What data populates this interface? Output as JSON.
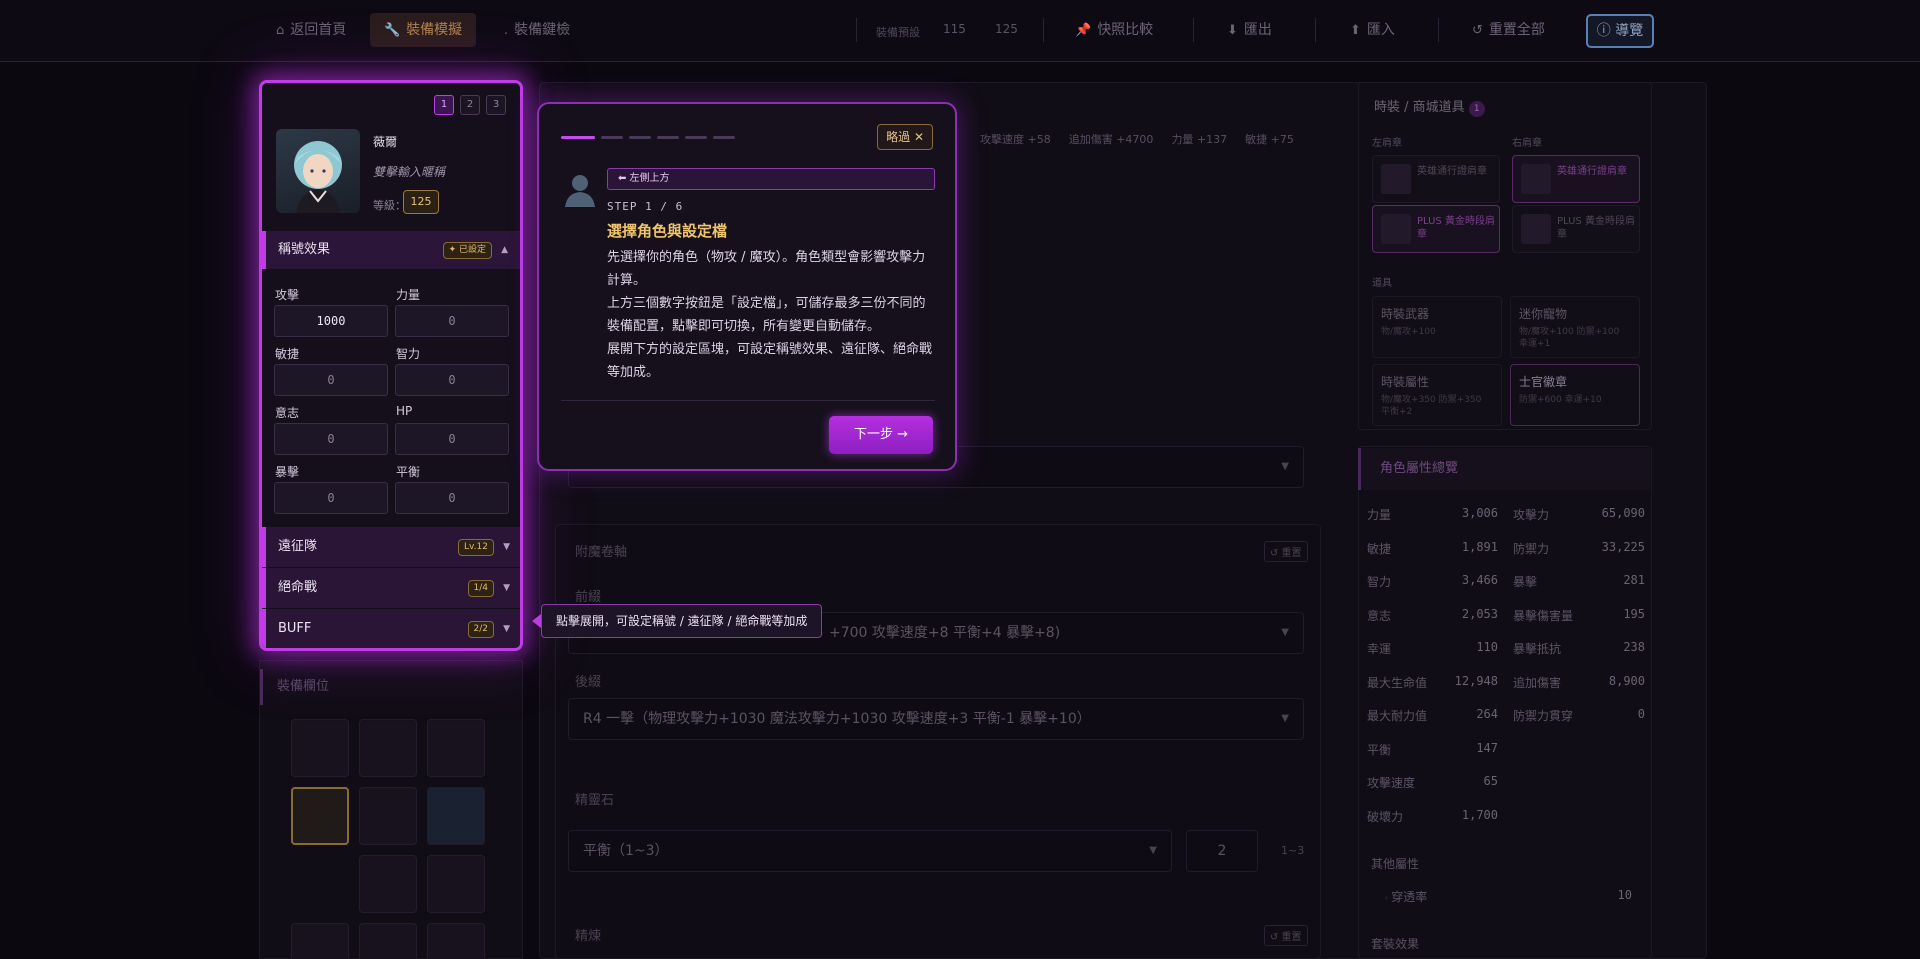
{
  "topbar": {
    "home": "返回首頁",
    "equip_sim": "裝備模擬",
    "shortcuts": "裝備鍵檢",
    "preset_label": "裝備預設",
    "preset_a": "115",
    "preset_b": "125",
    "quick_compare": "快照比較",
    "export": "匯出",
    "import": "匯入",
    "reset_all": "重置全部",
    "guide": "導覽"
  },
  "sidebar": {
    "slots": [
      "1",
      "2",
      "3"
    ],
    "character": {
      "name": "薇爾",
      "desc": "雙擊輸入暱稱",
      "level_label": "等級：",
      "level": "125"
    },
    "title_effect": {
      "label": "稱號效果",
      "badge": "✦ 已設定",
      "arrow": "▲",
      "stats": [
        {
          "label": "攻擊",
          "value": "1000"
        },
        {
          "label": "力量",
          "value": "0"
        },
        {
          "label": "敏捷",
          "value": "0"
        },
        {
          "label": "智力",
          "value": "0"
        },
        {
          "label": "意志",
          "value": "0"
        },
        {
          "label": "HP",
          "value": "0"
        },
        {
          "label": "暴擊",
          "value": "0"
        },
        {
          "label": "平衡",
          "value": "0"
        }
      ]
    },
    "accordions": [
      {
        "label": "遠征隊",
        "badge": "Lv.12",
        "arrow": "▼"
      },
      {
        "label": "絕命戰",
        "badge": "1/4",
        "arrow": "▼"
      },
      {
        "label": "BUFF",
        "badge": "2/2",
        "arrow": "▼"
      }
    ],
    "equipment_header": "裝備欄位"
  },
  "hint": {
    "text": "點擊展開，可設定稱號 / 遠征隊 / 絕命戰等加成"
  },
  "tour": {
    "position": "⬅ 左側上方",
    "step": "STEP 1 / 6",
    "title": "選擇角色與設定檔",
    "p1": "先選擇你的角色（物攻 / 魔攻）。角色類型會影響攻擊力計算。",
    "p2": "上方三個數字按鈕是「設定檔」，可儲存最多三份不同的裝備配置，點擊即可切換，所有變更自動儲存。",
    "p3": "展開下方的設定區塊，可設定稱號效果、遠征隊、絕命戰等加成。",
    "skip": "略過 ✕",
    "next": "下一步 →",
    "progress_total": 6,
    "progress_current": 1
  },
  "middle": {
    "top_stats": [
      "攻擊速度 +58",
      "追加傷害 +4700",
      "力量 +137",
      "敏捷 +75"
    ],
    "enchant_title": "附魔卷軸",
    "reset": "↺ 重置",
    "prefix_label": "前綴",
    "prefix_value": "+700 攻擊速度+8 平衡+4 暴擊+8)",
    "suffix_label": "後綴",
    "suffix_value": "R4 一擊（物理攻擊力+1030 魔法攻擊力+1030 攻擊速度+3 平衡-1 暴擊+10）",
    "spirit_title": "精靈石",
    "spirit_value": "平衡（1~3）",
    "spirit_num": "2",
    "spirit_range": "1~3",
    "refine_title": "精煉",
    "refine_reset": "↺ 重置"
  },
  "right": {
    "fashion_title": "時裝 / 商城道具",
    "fashion_count": "1",
    "left_badge": "左肩章",
    "right_badge": "右肩章",
    "badges": [
      {
        "name": "英雄通行證肩章",
        "hl": false
      },
      {
        "name": "英雄通行證肩章",
        "hl": true
      },
      {
        "name": "PLUS 黃金時段肩章",
        "hl": true
      },
      {
        "name": "PLUS 黃金時段肩章",
        "hl": false
      }
    ],
    "items_title": "道具",
    "props": [
      {
        "t": "時裝武器",
        "d": "物/魔攻+100",
        "hl": false
      },
      {
        "t": "迷你寵物",
        "d": "物/魔攻+100 防禦+100 幸運+1",
        "hl": false
      },
      {
        "t": "時裝屬性",
        "d": "物/魔攻+350 防禦+350 平衡+2",
        "hl": false
      },
      {
        "t": "士官徽章",
        "d": "防禦+600 幸運+10",
        "hl": true
      }
    ],
    "attrs_title": "角色屬性總覽",
    "attrs_left": [
      {
        "n": "力量",
        "v": "3,006"
      },
      {
        "n": "敏捷",
        "v": "1,891"
      },
      {
        "n": "智力",
        "v": "3,466"
      },
      {
        "n": "意志",
        "v": "2,053"
      },
      {
        "n": "幸運",
        "v": "110"
      },
      {
        "n": "最大生命值",
        "v": "12,948"
      },
      {
        "n": "最大耐力值",
        "v": "264"
      },
      {
        "n": "平衡",
        "v": "147"
      },
      {
        "n": "攻擊速度",
        "v": "65"
      },
      {
        "n": "破壞力",
        "v": "1,700"
      }
    ],
    "attrs_right": [
      {
        "n": "攻擊力",
        "v": "65,090"
      },
      {
        "n": "防禦力",
        "v": "33,225"
      },
      {
        "n": "暴擊",
        "v": "281"
      },
      {
        "n": "暴擊傷害量",
        "v": "195"
      },
      {
        "n": "暴擊抵抗",
        "v": "238"
      },
      {
        "n": "追加傷害",
        "v": "8,900"
      },
      {
        "n": "防禦力貫穿",
        "v": "0"
      }
    ],
    "other_title": "其他屬性",
    "pen_label": "穿透率",
    "pen_value": "10",
    "set_title": "套裝效果"
  }
}
